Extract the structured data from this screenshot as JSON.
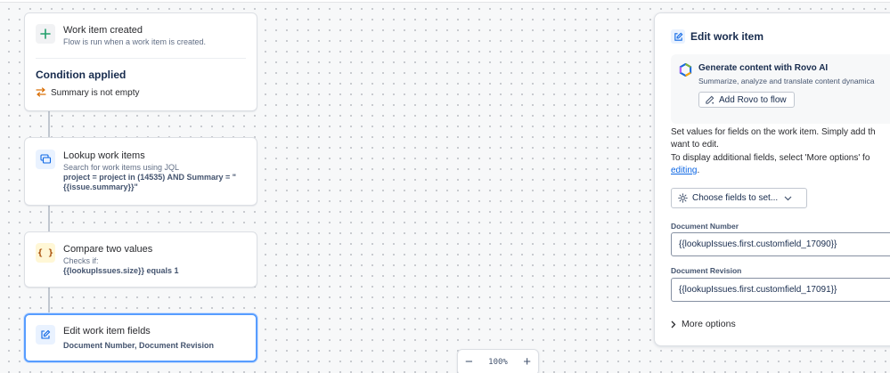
{
  "flow": {
    "trigger": {
      "title": "Work item created",
      "subtitle": "Flow is run when a work item is created.",
      "condition_title": "Condition applied",
      "condition_text": "Summary is not empty"
    },
    "lookup": {
      "title": "Lookup work items",
      "subtitle": "Search for work items using JQL",
      "query_line1": "project = project in (14535) AND Summary = \"",
      "query_line2": "{{issue.summary}}\""
    },
    "compare": {
      "title": "Compare two values",
      "subtitle": "Checks if:",
      "detail": "{{lookupIssues.size}} equals 1"
    },
    "edit": {
      "title": "Edit work item fields",
      "detail": "Document Number, Document Revision"
    }
  },
  "zoom": {
    "minus": "−",
    "value": "100%",
    "plus": "+"
  },
  "panel": {
    "title": "Edit work item",
    "rovo": {
      "title": "Generate content with Rovo AI",
      "description": "Summarize, analyze and translate content dynamica",
      "button_label": "Add Rovo to flow"
    },
    "intro_line1": "Set values for fields on the work item. Simply add th",
    "intro_line2": "want to edit.",
    "intro_line3": "To display additional fields, select 'More options' fo",
    "intro_link": "editing",
    "intro_period": ".",
    "choose_fields": "Choose fields to set...",
    "fields": [
      {
        "label": "Document Number",
        "value": "{{lookupIssues.first.customfield_17090}}"
      },
      {
        "label": "Document Revision",
        "value": "{{lookupIssues.first.customfield_17091}}"
      }
    ],
    "more_options": "More options"
  },
  "colors": {
    "accent": "#0c66e4",
    "selected_border": "#579dff",
    "plus_green": "#22a06b",
    "swap_orange": "#e2b203"
  },
  "icons": {
    "trigger": "plus-icon",
    "condition": "swap-arrows-icon",
    "lookup": "search-items-icon",
    "compare": "braces-icon",
    "edit": "edit-icon",
    "rovo": "rovo-logo-icon",
    "settings": "gear-icon",
    "more": "chevron-right-icon"
  }
}
